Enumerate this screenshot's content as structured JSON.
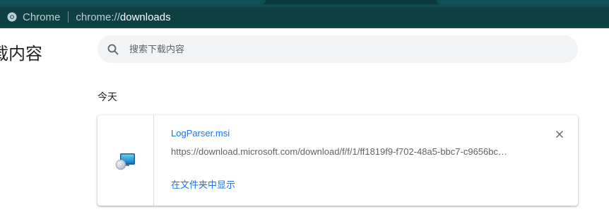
{
  "browser": {
    "app_label": "Chrome",
    "url_scheme": "chrome://",
    "url_host": "downloads"
  },
  "page": {
    "heading": "下载内容"
  },
  "search": {
    "placeholder": "搜索下载内容",
    "icon": "search-icon"
  },
  "downloads": {
    "groups": [
      {
        "date_label": "今天",
        "items": [
          {
            "file_name": "LogParser.msi",
            "url": "https://download.microsoft.com/download/f/f/1/ff1819f9-f702-48a5-bbc7-c9656bc…",
            "action_label": "在文件夹中显示",
            "icon": "installer-file-icon",
            "remove_icon": "close-icon"
          }
        ]
      }
    ]
  },
  "colors": {
    "accent": "#1a73e8",
    "toolbar": "#0f4b50",
    "search_bg": "#f1f3f4"
  }
}
